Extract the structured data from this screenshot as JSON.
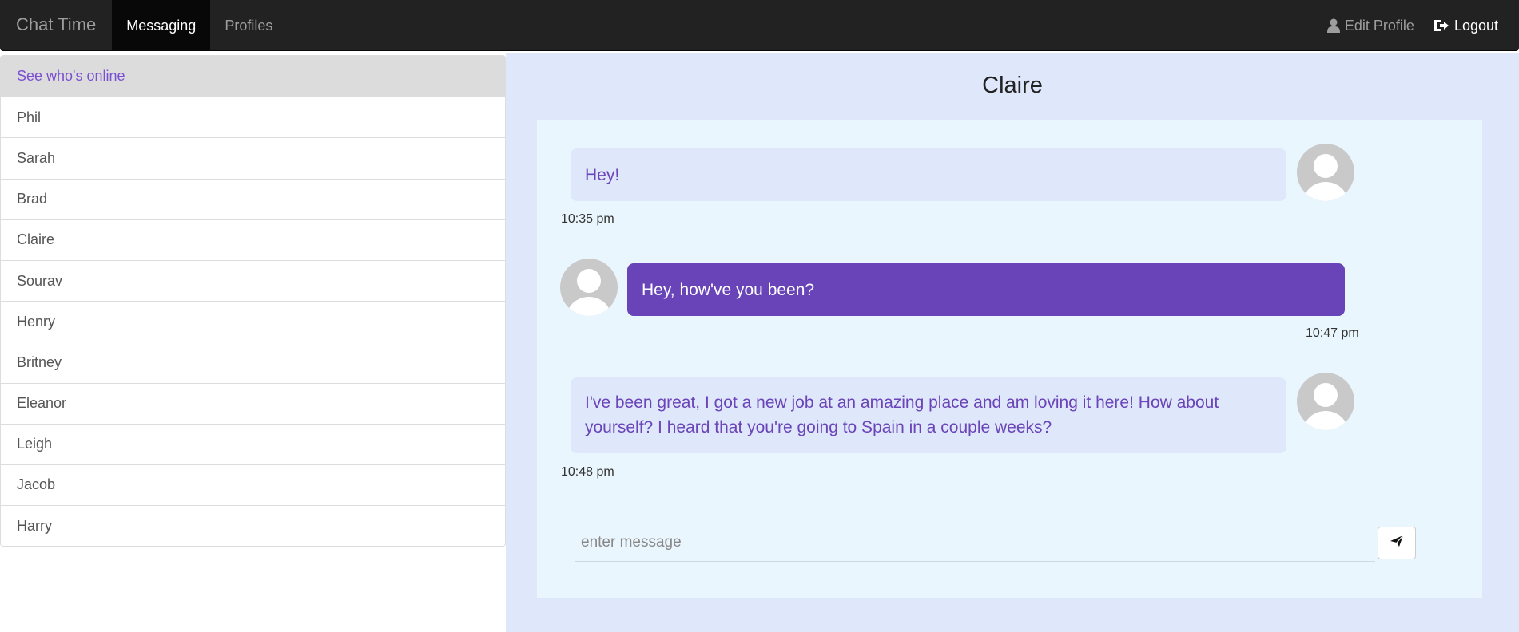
{
  "navbar": {
    "brand": "Chat Time",
    "links": [
      {
        "label": "Messaging",
        "active": true
      },
      {
        "label": "Profiles",
        "active": false
      }
    ],
    "right_links": [
      {
        "label": "Edit Profile",
        "icon": "user-icon"
      },
      {
        "label": "Logout",
        "icon": "logout-icon"
      }
    ]
  },
  "sidebar": {
    "header": "See who's online",
    "users": [
      "Phil",
      "Sarah",
      "Brad",
      "Claire",
      "Sourav",
      "Henry",
      "Britney",
      "Eleanor",
      "Leigh",
      "Jacob",
      "Harry"
    ]
  },
  "chat": {
    "title": "Claire",
    "messages": [
      {
        "text": "Hey!",
        "time": "10:35 pm",
        "direction": "received"
      },
      {
        "text": "Hey, how've you been?",
        "time": "10:47 pm",
        "direction": "sent"
      },
      {
        "text": "I've been great, I got a new job at an amazing place and am loving it here! How about yourself? I heard that you're going to Spain in a couple weeks?",
        "time": "10:48 pm",
        "direction": "received"
      }
    ],
    "input_placeholder": "enter message",
    "input_value": "",
    "send_icon": "send-icon"
  },
  "colors": {
    "navbar_bg": "#222222",
    "accent_purple": "#6844b8",
    "received_bubble_bg": "#dfe8fb",
    "chat_area_bg": "#eaf6fd"
  }
}
